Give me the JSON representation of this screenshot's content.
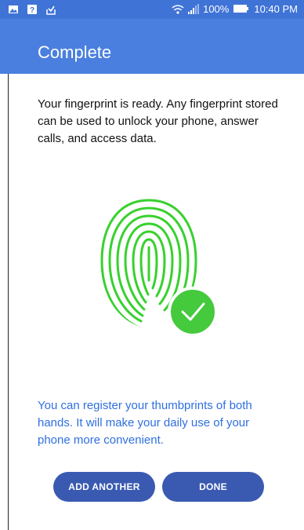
{
  "status_bar": {
    "battery": "100%",
    "time": "10:40 PM",
    "icons": [
      "image-icon",
      "question-icon",
      "download-icon",
      "wifi-icon",
      "signal-icon",
      "battery-icon"
    ]
  },
  "app_bar": {
    "title": "Complete"
  },
  "main": {
    "description": "Your fingerprint is ready. Any fingerprint stored can be used to unlock your phone, answer calls, and access data.",
    "hint": "You can register your thumbprints of both hands. It will make your daily use of your phone more convenient.",
    "illustration": {
      "icon": "fingerprint-icon",
      "badge": "checkmark-icon",
      "color": "#38d12e",
      "badge_color": "#45c93d"
    }
  },
  "actions": {
    "add_another": "ADD ANOTHER",
    "done": "DONE"
  },
  "colors": {
    "primary": "#4a7fdf",
    "status": "#3f73d6",
    "button": "#3a5ab1",
    "hint_text": "#2f6fe0"
  }
}
